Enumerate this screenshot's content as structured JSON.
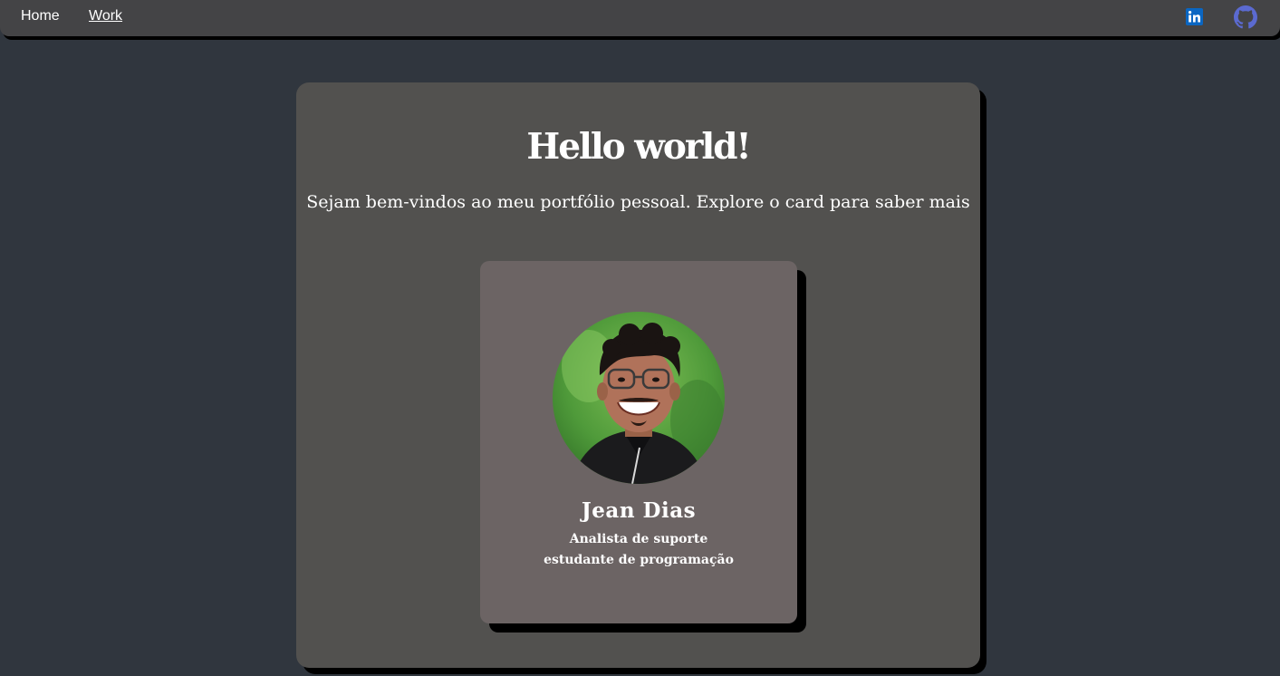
{
  "nav": {
    "home_label": "Home",
    "work_label": "Work",
    "icons": [
      "linkedin-icon",
      "github-icon"
    ]
  },
  "hero": {
    "title": "Hello world!",
    "subtitle": "Sejam bem-vindos ao meu portfólio pessoal. Explore o card para saber mais"
  },
  "profile": {
    "name": "Jean Dias",
    "role_line1": "Analista de suporte",
    "role_line2": "estudante de programação",
    "avatar": "profile-photo"
  },
  "colors": {
    "background": "#30363e",
    "navbar": "#444446",
    "panel": "#52514f",
    "card": "#6c6464",
    "text": "#ffffff",
    "linkedin": "#0a66c2",
    "github": "#5b6ad0"
  }
}
